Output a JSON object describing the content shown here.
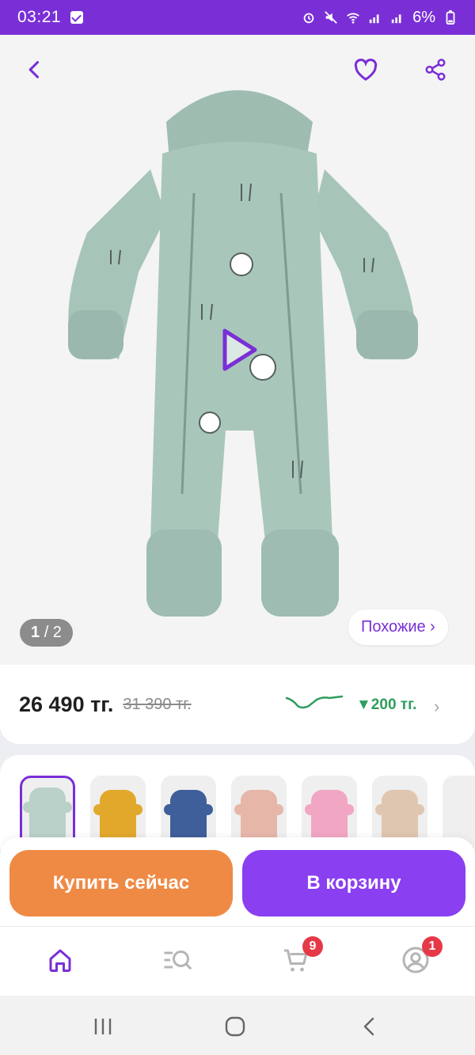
{
  "status_bar": {
    "time": "03:21",
    "battery": "6%"
  },
  "hero": {
    "image_counter": {
      "current": "1",
      "total": "/ 2"
    },
    "similar_button": "Похожие ›"
  },
  "price": {
    "current": "26 490 тг.",
    "old": "31 390 тг.",
    "drop": "▼200 тг.",
    "chevron": "›"
  },
  "variants": [
    {
      "color": "#b9d1c8",
      "selected": true
    },
    {
      "color": "#e2a82c",
      "selected": false
    },
    {
      "color": "#3f5f9a",
      "selected": false
    },
    {
      "color": "#e6b6a9",
      "selected": false
    },
    {
      "color": "#f1a6c4",
      "selected": false
    },
    {
      "color": "#dfc6b1",
      "selected": false
    }
  ],
  "actions": {
    "buy_now": "Купить сейчас",
    "add_to_cart": "В корзину"
  },
  "bottom_nav": {
    "cart_badge": "9",
    "profile_badge": "1"
  },
  "colors": {
    "accent": "#7a2fd6",
    "buy": "#ef8a45",
    "cart": "#8a3ff0",
    "price_drop": "#2e9d5e"
  }
}
